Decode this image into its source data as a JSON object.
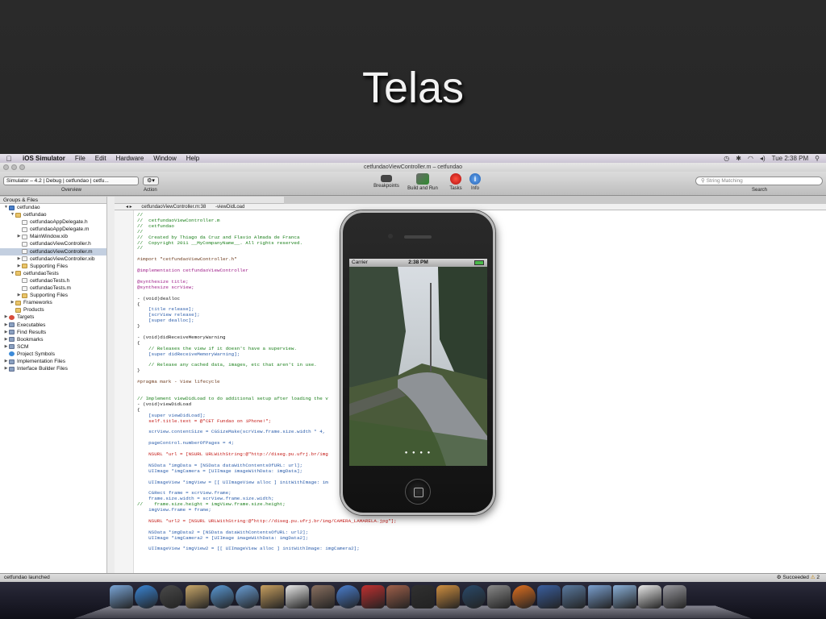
{
  "slide": {
    "title": "Telas"
  },
  "menubar": {
    "app": "iOS Simulator",
    "items": [
      "File",
      "Edit",
      "Hardware",
      "Window",
      "Help"
    ],
    "clock": "Tue 2:38 PM"
  },
  "window": {
    "title": "cetfundaoViewController.m – cetfundao"
  },
  "toolbar": {
    "scheme": "Simulator – 4.2 | Debug | cetfundao | cetfu...",
    "overview_label": "Overview",
    "action_label": "Action",
    "breakpoints": "Breakpoints",
    "build_run": "Build and Run",
    "tasks": "Tasks",
    "info": "Info",
    "search_placeholder": "String Matching",
    "search_label": "Search"
  },
  "sidebar": {
    "header": "Groups & Files",
    "items": [
      {
        "label": "cetfundao",
        "indent": 0,
        "icon": "proj",
        "tri": "▼"
      },
      {
        "label": "cetfundao",
        "indent": 1,
        "icon": "folder",
        "tri": "▼"
      },
      {
        "label": "cetfundaoAppDelegate.h",
        "indent": 2,
        "icon": "doc",
        "tri": ""
      },
      {
        "label": "cetfundaoAppDelegate.m",
        "indent": 2,
        "icon": "doc",
        "tri": ""
      },
      {
        "label": "MainWindow.xib",
        "indent": 2,
        "icon": "doc",
        "tri": "▶"
      },
      {
        "label": "cetfundaoViewController.h",
        "indent": 2,
        "icon": "doc",
        "tri": ""
      },
      {
        "label": "cetfundaoViewController.m",
        "indent": 2,
        "icon": "doc",
        "tri": "",
        "selected": true
      },
      {
        "label": "cetfundaoViewController.xib",
        "indent": 2,
        "icon": "doc",
        "tri": "▶"
      },
      {
        "label": "Supporting Files",
        "indent": 2,
        "icon": "folder",
        "tri": "▶"
      },
      {
        "label": "cetfundaoTests",
        "indent": 1,
        "icon": "folder",
        "tri": "▼"
      },
      {
        "label": "cetfundaoTests.h",
        "indent": 2,
        "icon": "doc",
        "tri": ""
      },
      {
        "label": "cetfundaoTests.m",
        "indent": 2,
        "icon": "doc",
        "tri": ""
      },
      {
        "label": "Supporting Files",
        "indent": 2,
        "icon": "folder",
        "tri": "▶"
      },
      {
        "label": "Frameworks",
        "indent": 1,
        "icon": "folder",
        "tri": "▶"
      },
      {
        "label": "Products",
        "indent": 1,
        "icon": "folder",
        "tri": ""
      },
      {
        "label": "Targets",
        "indent": 0,
        "icon": "red",
        "tri": "▶"
      },
      {
        "label": "Executables",
        "indent": 0,
        "icon": "misc",
        "tri": "▶"
      },
      {
        "label": "Find Results",
        "indent": 0,
        "icon": "misc",
        "tri": "▶"
      },
      {
        "label": "Bookmarks",
        "indent": 0,
        "icon": "misc",
        "tri": "▶"
      },
      {
        "label": "SCM",
        "indent": 0,
        "icon": "misc",
        "tri": "▶"
      },
      {
        "label": "Project Symbols",
        "indent": 0,
        "icon": "blue",
        "tri": ""
      },
      {
        "label": "Implementation Files",
        "indent": 0,
        "icon": "misc",
        "tri": "▶"
      },
      {
        "label": "Interface Builder Files",
        "indent": 0,
        "icon": "misc",
        "tri": "▶"
      }
    ]
  },
  "editor": {
    "file_crumb": "cetfundaoViewController.m:38",
    "method_crumb": "-viewDidLoad"
  },
  "code_lines": [
    [
      "c",
      "//"
    ],
    [
      "c",
      "//  cetfundaoViewController.m"
    ],
    [
      "c",
      "//  cetfundao"
    ],
    [
      "c",
      "//"
    ],
    [
      "c",
      "//  Created by Thiago da Cruz and Flavio Almada de Franca"
    ],
    [
      "c",
      "//  Copyright 2011 __MyCompanyName__. All rights reserved."
    ],
    [
      "c",
      "//"
    ],
    [
      "",
      ""
    ],
    [
      "p",
      "#import \"cetfundaoViewController.h\""
    ],
    [
      "",
      ""
    ],
    [
      "k",
      "@implementation cetfundaoViewController"
    ],
    [
      "",
      ""
    ],
    [
      "k",
      "@synthesize title;"
    ],
    [
      "k",
      "@synthesize scrView;"
    ],
    [
      "",
      ""
    ],
    [
      "",
      "- (void)dealloc"
    ],
    [
      "",
      "{"
    ],
    [
      "t",
      "    [title release];"
    ],
    [
      "t",
      "    [scrView release];"
    ],
    [
      "t",
      "    [super dealloc];"
    ],
    [
      "",
      "}"
    ],
    [
      "",
      ""
    ],
    [
      "",
      "- (void)didReceiveMemoryWarning"
    ],
    [
      "",
      "{"
    ],
    [
      "c",
      "    // Releases the view if it doesn't have a superview."
    ],
    [
      "t",
      "    [super didReceiveMemoryWarning];"
    ],
    [
      "",
      ""
    ],
    [
      "c",
      "    // Release any cached data, images, etc that aren't in use."
    ],
    [
      "",
      "}"
    ],
    [
      "",
      ""
    ],
    [
      "p",
      "#pragma mark - View lifecycle"
    ],
    [
      "",
      ""
    ],
    [
      "",
      ""
    ],
    [
      "c",
      "// Implement viewDidLoad to do additional setup after loading the v"
    ],
    [
      "",
      "- (void)viewDidLoad"
    ],
    [
      "",
      "{"
    ],
    [
      "t",
      "    [super viewDidLoad];"
    ],
    [
      "s",
      "    self.title.text = @\"CET Fundao on iPhone!\";"
    ],
    [
      "",
      ""
    ],
    [
      "t",
      "    scrView.contentSize = CGSizeMake(scrView.frame.size.width * 4,"
    ],
    [
      "",
      ""
    ],
    [
      "t",
      "    pageControl.numberOfPages = 4;"
    ],
    [
      "",
      ""
    ],
    [
      "s",
      "    NSURL *url = [NSURL URLWithString:@\"http://diseg.pu.ufrj.br/img"
    ],
    [
      "",
      ""
    ],
    [
      "t",
      "    NSData *imgData = [NSData dataWithContentsOfURL: url];"
    ],
    [
      "t",
      "    UIImage *imgCamera = [UIImage imageWithData: imgData];"
    ],
    [
      "",
      ""
    ],
    [
      "t",
      "    UIImageView *imgView = [[ UIImageView alloc ] initWithImage: im"
    ],
    [
      "",
      ""
    ],
    [
      "t",
      "    CGRect frame = scrView.frame;"
    ],
    [
      "t",
      "    frame.size.width = scrView.frame.size.width;"
    ],
    [
      "c",
      "//    frame.size.height = imgView.frame.size.height;"
    ],
    [
      "t",
      "    imgView.frame = frame;"
    ],
    [
      "",
      ""
    ],
    [
      "s",
      "    NSURL *url2 = [NSURL URLWithString:@\"http://diseg.pu.ufrj.br/img/CAMERA_LAMARELA.jpg\"];"
    ],
    [
      "",
      ""
    ],
    [
      "t",
      "    NSData *imgData2 = [NSData dataWithContentsOfURL: url2];"
    ],
    [
      "t",
      "    UIImage *imgCamera2 = [UIImage imageWithData: imgData2];"
    ],
    [
      "",
      ""
    ],
    [
      "t",
      "    UIImageView *imgView2 = [[ UIImageView alloc ] initWithImage: imgCamera2];"
    ]
  ],
  "status": {
    "left": "cetfundao launched",
    "right": "Succeeded",
    "warnings": "2"
  },
  "iphone": {
    "carrier": "Carrier",
    "time": "2:38 PM"
  },
  "colors": {
    "accent": "#3c8ad8",
    "selection": "#c3cfe0"
  },
  "dock_icons": [
    "finder-icon",
    "app-store-icon",
    "dashboard-icon",
    "mail-stamp-icon",
    "safari-icon",
    "facetime-icon",
    "address-book-icon",
    "ical-icon",
    "iphoto-icon",
    "itunes-icon",
    "photo-booth-icon",
    "iphoto2-icon",
    "imovie-icon",
    "garageband-icon",
    "time-machine-icon",
    "system-prefs-icon",
    "firefox-icon",
    "xcode-icon",
    "instruments-icon",
    "folder-icon",
    "documents-folder-icon",
    "zip-icon",
    "trash-icon"
  ]
}
